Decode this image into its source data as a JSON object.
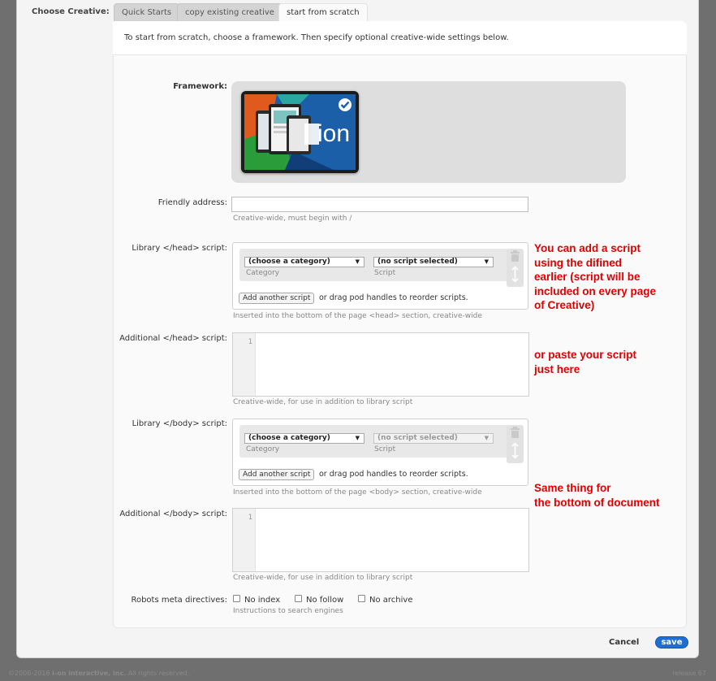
{
  "choose_creative": {
    "label": "Choose Creative:",
    "tabs": [
      {
        "label": "Quick Starts",
        "active": false
      },
      {
        "label": "copy existing creative",
        "active": false
      },
      {
        "label": "start from scratch",
        "active": true
      }
    ]
  },
  "intro_text": "To start from scratch, choose a framework. Then specify optional creative-wide settings below.",
  "framework": {
    "label": "Framework:",
    "logo_text": "ion",
    "selected": true
  },
  "friendly_address": {
    "label": "Friendly address:",
    "value": "",
    "hint": "Creative-wide, must begin with /"
  },
  "library_head": {
    "label": "Library </head> script:",
    "category_value": "(choose a category)",
    "category_sublabel": "Category",
    "script_value": "(no script selected)",
    "script_sublabel": "Script",
    "add_button": "Add another script",
    "after_button": "or drag pod handles to reorder scripts.",
    "hint": "Inserted into the bottom of the page <head> section, creative-wide"
  },
  "additional_head": {
    "label": "Additional </head> script:",
    "line_number": "1",
    "hint": "Creative-wide, for use in addition to library script"
  },
  "library_body": {
    "label": "Library </body> script:",
    "category_value": "(choose a category)",
    "category_sublabel": "Category",
    "script_value": "(no script selected)",
    "script_sublabel": "Script",
    "add_button": "Add another script",
    "after_button": "or drag pod handles to reorder scripts.",
    "hint": "Inserted into the bottom of the page <body> section, creative-wide"
  },
  "additional_body": {
    "label": "Additional </body> script:",
    "line_number": "1",
    "hint": "Creative-wide, for use in addition to library script"
  },
  "robots": {
    "label": "Robots meta directives:",
    "options": [
      "No index",
      "No follow",
      "No archive"
    ],
    "hint": "Instructions to search engines"
  },
  "annotations": {
    "library_script": "You can add a script\nusing the difined\nearlier (script will be\nincluded on every page\nof Creative)",
    "paste_script": "or paste your script\njust here",
    "bottom_document": "Same thing for\nthe bottom of document"
  },
  "actions": {
    "cancel": "Cancel",
    "save": "save"
  },
  "footer": {
    "copyright_prefix": "©2006-2016",
    "copyright_company": "i-on interactive, inc.",
    "copyright_suffix": "All rights reserved.",
    "release": "release 67"
  },
  "colors": {
    "annotation": "#e00000",
    "save_button": "#1f6fd0",
    "page_background": "#6f6f6f"
  }
}
